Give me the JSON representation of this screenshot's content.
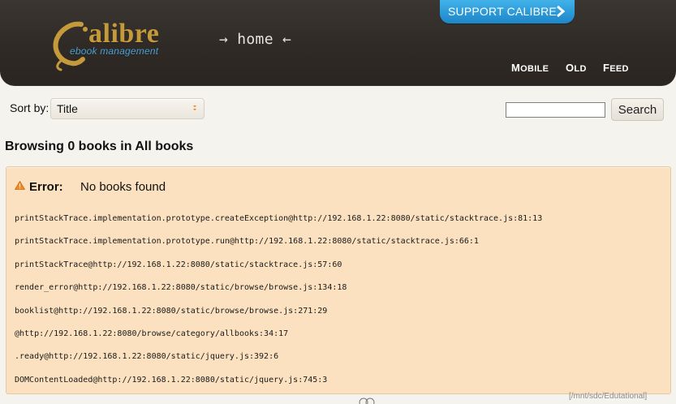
{
  "header": {
    "logo_word": "alibre",
    "logo_sub": "ebook management",
    "home": {
      "left_arrow": "→",
      "label": "home",
      "right_arrow": "←"
    },
    "support_label": "SUPPORT CALIBRE",
    "nav": [
      {
        "label": "MOBILE",
        "first": "M",
        "rest": "OBILE"
      },
      {
        "label": "OLD",
        "first": "O",
        "rest": "LD"
      },
      {
        "label": "FEED",
        "first": "F",
        "rest": "EED"
      }
    ]
  },
  "toolbar": {
    "sort_label": "Sort by:",
    "sort_value": "Title",
    "search_value": "",
    "search_button": "Search"
  },
  "browse": {
    "title": "Browsing 0 books in All books"
  },
  "error": {
    "label": "Error:",
    "message": "No books found",
    "trace": [
      "printStackTrace.implementation.prototype.createException@http://192.168.1.22:8080/static/stacktrace.js:81:13",
      "printStackTrace.implementation.prototype.run@http://192.168.1.22:8080/static/stacktrace.js:66:1",
      "printStackTrace@http://192.168.1.22:8080/static/stacktrace.js:57:60",
      "render_error@http://192.168.1.22:8080/static/browse/browse.js:134:18",
      "booklist@http://192.168.1.22:8080/static/browse/browse.js:271:29",
      "@http://192.168.1.22:8080/browse/category/allbooks:34:17",
      ".ready@http://192.168.1.22:8080/static/jquery.js:392:6",
      "DOMContentLoaded@http://192.168.1.22:8080/static/jquery.js:745:3"
    ]
  },
  "footer": {
    "watermark": "[/mnt/sdc/Edutational]"
  },
  "colors": {
    "header_bg": "#2f2a25",
    "accent_blue": "#2a97d6",
    "logo_gold": "#c59a3b",
    "logo_blue": "#4aa0d6",
    "error_bg": "#fbe1bf"
  },
  "icons": {
    "support": "chevron-right-icon",
    "sort": "chevron-down-icon",
    "warning": "warning-icon"
  }
}
